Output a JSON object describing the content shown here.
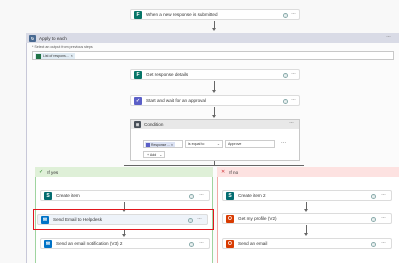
{
  "trigger": {
    "label": "When a new response is submitted",
    "icon": "forms-icon",
    "color": "#077568"
  },
  "apply": {
    "title": "Apply to each",
    "hint": "* Select an output from previous steps",
    "token": "List of respons...",
    "header_color": "#c8c8d8",
    "icon_color": "#486991"
  },
  "get_details": {
    "label": "Get response details",
    "color": "#077568"
  },
  "approval": {
    "label": "Start and wait for an approval",
    "color": "#5b5fc7"
  },
  "condition": {
    "title": "Condition",
    "field_token": "Response ...",
    "operator": "is equal to",
    "value": "Approve",
    "add_label": "+ Add",
    "header_color": "#484f58"
  },
  "branch_yes": {
    "title": "If yes",
    "color": "#dff0d8",
    "actions": [
      {
        "label": "Create item",
        "color": "#036c70",
        "icon": "sharepoint-icon"
      },
      {
        "label": "Send Email to Helpdesk",
        "color": "#0072c6",
        "icon": "mail-icon",
        "highlighted": true
      },
      {
        "label": "Send an email notification (V3) 2",
        "color": "#0072c6",
        "icon": "mail-icon"
      }
    ]
  },
  "branch_no": {
    "title": "If no",
    "color": "#fde2e1",
    "actions": [
      {
        "label": "Create item 2",
        "color": "#036c70",
        "icon": "sharepoint-icon"
      },
      {
        "label": "Get my profile (V2)",
        "color": "#d83b01",
        "icon": "office-icon"
      },
      {
        "label": "Send an email",
        "color": "#d83b01",
        "icon": "office-icon"
      }
    ]
  },
  "ui": {
    "more": "···",
    "help": "?",
    "highlight_color": "#e2171e"
  }
}
